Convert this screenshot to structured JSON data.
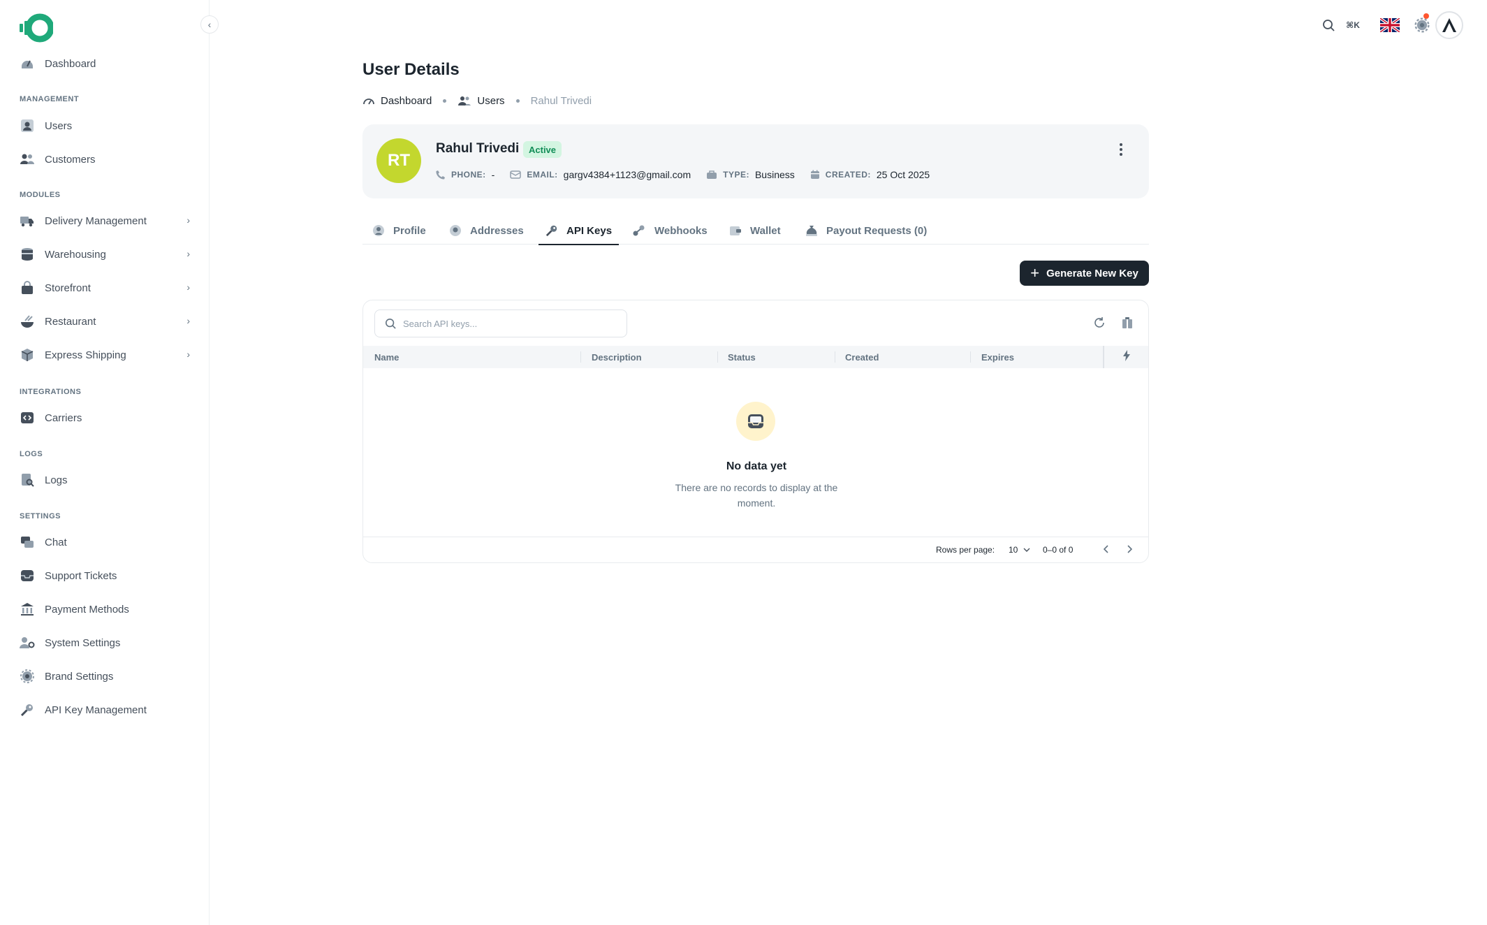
{
  "sidebar": {
    "items": [
      {
        "label": "Dashboard"
      },
      {
        "section": "MANAGEMENT"
      },
      {
        "label": "Users"
      },
      {
        "label": "Customers"
      },
      {
        "section": "MODULES"
      },
      {
        "label": "Delivery Management"
      },
      {
        "label": "Warehousing"
      },
      {
        "label": "Storefront"
      },
      {
        "label": "Restaurant"
      },
      {
        "label": "Express Shipping"
      },
      {
        "section": "INTEGRATIONS"
      },
      {
        "label": "Carriers"
      },
      {
        "section": "LOGS"
      },
      {
        "label": "Logs"
      },
      {
        "section": "SETTINGS"
      },
      {
        "label": "Chat"
      },
      {
        "label": "Support Tickets"
      },
      {
        "label": "Payment Methods"
      },
      {
        "label": "System Settings"
      },
      {
        "label": "Brand Settings"
      },
      {
        "label": "API Key Management"
      }
    ]
  },
  "topbar": {
    "shortcut": "⌘K",
    "notification_color": "#ff5630"
  },
  "page": {
    "title": "User Details",
    "breadcrumb": [
      "Dashboard",
      "Users",
      "Rahul Trivedi"
    ]
  },
  "user": {
    "initials": "RT",
    "name": "Rahul Trivedi",
    "status": "Active",
    "avatar_color": "#c3d72e",
    "phone_label": "PHONE:",
    "phone": "-",
    "email_label": "EMAIL:",
    "email": "gargv4384+1123@gmail.com",
    "type_label": "TYPE:",
    "type": "Business",
    "created_label": "CREATED:",
    "created": "25 Oct 2025"
  },
  "tabs": [
    "Profile",
    "Addresses",
    "API Keys",
    "Webhooks",
    "Wallet",
    "Payout Requests (0)"
  ],
  "active_tab": "API Keys",
  "actions": {
    "generate_label": "Generate New Key"
  },
  "table": {
    "search_placeholder": "Search API keys...",
    "columns": [
      "Name",
      "Description",
      "Status",
      "Created",
      "Expires"
    ],
    "empty_title": "No data yet",
    "empty_desc": "There are no records to display at the moment.",
    "rows_per_page_label": "Rows per page:",
    "rows_per_page": "10",
    "range": "0–0 of 0"
  }
}
